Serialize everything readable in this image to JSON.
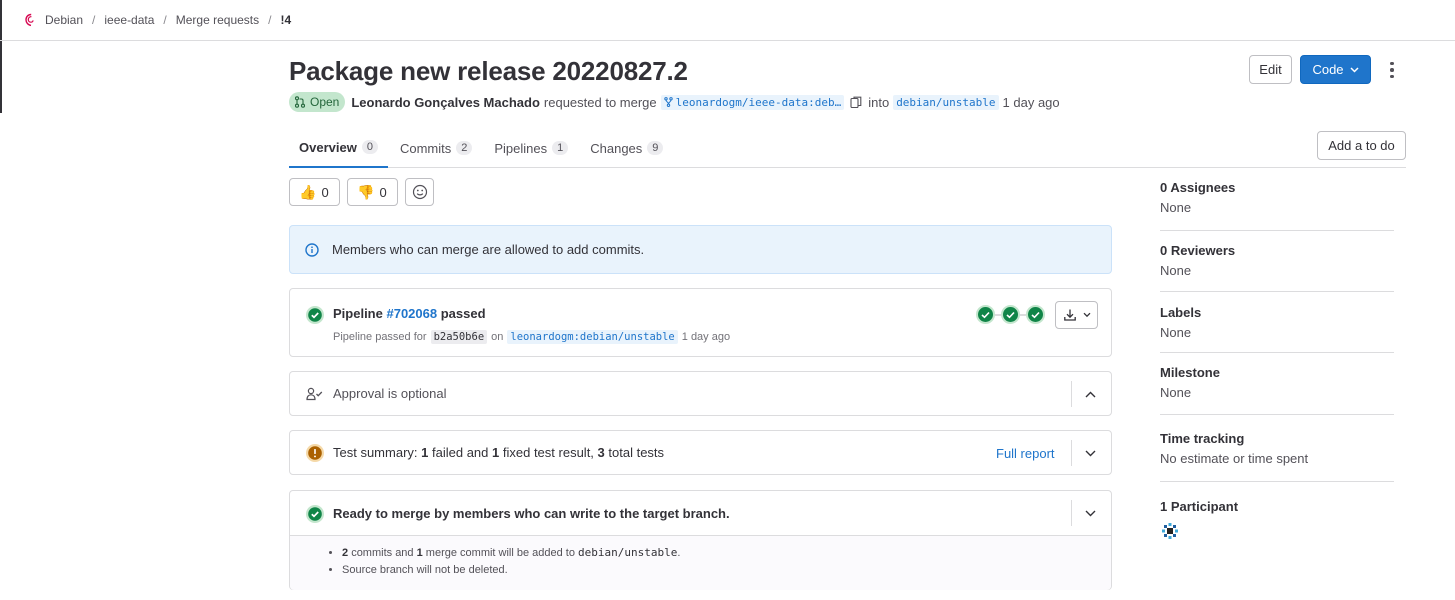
{
  "breadcrumb": {
    "items": [
      "Debian",
      "ieee-data",
      "Merge requests",
      "!4"
    ]
  },
  "mr": {
    "title": "Package new release 20220827.2",
    "status": "Open",
    "author": "Leonardo Gonçalves Machado",
    "requested_text": "requested to merge",
    "source_branch": "leonardogm/ieee-data:deb…",
    "into_text": "into",
    "target_branch": "debian/unstable",
    "time_ago": "1 day ago"
  },
  "actions": {
    "edit": "Edit",
    "code": "Code",
    "add_todo": "Add a to do"
  },
  "tabs": [
    {
      "label": "Overview",
      "count": "0"
    },
    {
      "label": "Commits",
      "count": "2"
    },
    {
      "label": "Pipelines",
      "count": "1"
    },
    {
      "label": "Changes",
      "count": "9"
    }
  ],
  "reactions": {
    "thumbs_up": "0",
    "thumbs_down": "0"
  },
  "info_alert": "Members who can merge are allowed to add commits.",
  "pipeline": {
    "prefix": "Pipeline",
    "id": "#702068",
    "status": "passed",
    "sub_prefix": "Pipeline passed for",
    "sha": "b2a50b6e",
    "on": "on",
    "branch": "leonardogm:debian/unstable",
    "time_ago": "1 day ago",
    "stage_color": "#108548"
  },
  "approval": {
    "text": "Approval is optional"
  },
  "tests": {
    "prefix": "Test summary:",
    "failed_count": "1",
    "failed_text": "failed and",
    "fixed_count": "1",
    "fixed_text": "fixed test result,",
    "total_count": "3",
    "total_text": "total tests",
    "full_report": "Full report"
  },
  "ready": {
    "title": "Ready to merge by members who can write to the target branch.",
    "line1_commits": "2",
    "line1_a": "commits and",
    "line1_merge": "1",
    "line1_b": "merge commit will be added to",
    "line1_branch": "debian/unstable",
    "line1_end": ".",
    "line2": "Source branch will not be deleted."
  },
  "sidebar": {
    "assignees_title": "0 Assignees",
    "assignees_value": "None",
    "reviewers_title": "0 Reviewers",
    "reviewers_value": "None",
    "labels_title": "Labels",
    "labels_value": "None",
    "milestone_title": "Milestone",
    "milestone_value": "None",
    "time_title": "Time tracking",
    "time_value": "No estimate or time spent",
    "participants_title": "1 Participant"
  },
  "colors": {
    "primary": "#1f75cb",
    "success": "#108548",
    "warning": "#ab6100"
  }
}
